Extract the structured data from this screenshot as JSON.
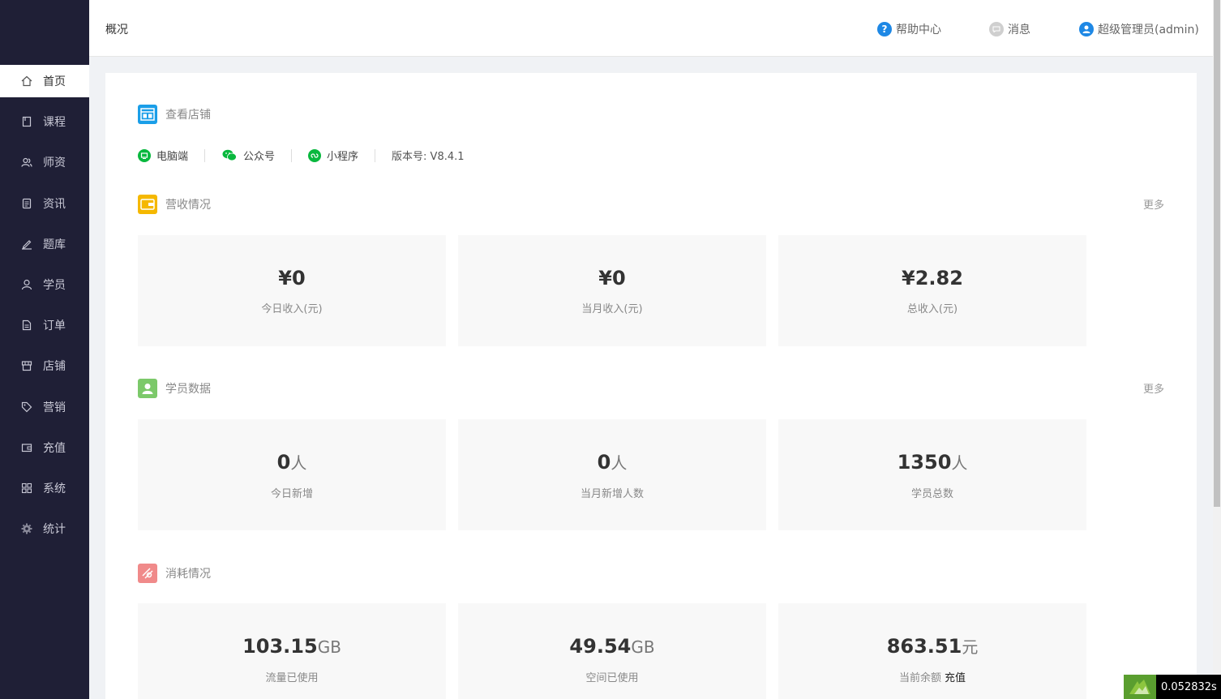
{
  "sidebar": {
    "items": [
      {
        "label": "首页",
        "icon": "home-icon",
        "active": true
      },
      {
        "label": "课程",
        "icon": "book-icon"
      },
      {
        "label": "师资",
        "icon": "teachers-icon"
      },
      {
        "label": "资讯",
        "icon": "news-icon"
      },
      {
        "label": "题库",
        "icon": "pen-icon"
      },
      {
        "label": "学员",
        "icon": "user-icon"
      },
      {
        "label": "订单",
        "icon": "document-icon"
      },
      {
        "label": "店铺",
        "icon": "store-icon"
      },
      {
        "label": "营销",
        "icon": "tag-icon"
      },
      {
        "label": "充值",
        "icon": "wallet-icon"
      },
      {
        "label": "系统",
        "icon": "grid-icon"
      },
      {
        "label": "统计",
        "icon": "gear-icon"
      }
    ]
  },
  "header": {
    "breadcrumb": "概况",
    "help": "帮助中心",
    "messages": "消息",
    "user": "超级管理员(admin)"
  },
  "store": {
    "title": "查看店铺",
    "platforms": [
      "电脑端",
      "公众号",
      "小程序"
    ],
    "version": "版本号: V8.4.1"
  },
  "revenue": {
    "title": "营收情况",
    "more": "更多",
    "cards": [
      {
        "value": "¥0",
        "label": "今日收入(元)"
      },
      {
        "value": "¥0",
        "label": "当月收入(元)"
      },
      {
        "value": "¥2.82",
        "label": "总收入(元)"
      }
    ]
  },
  "students": {
    "title": "学员数据",
    "more": "更多",
    "cards": [
      {
        "value": "0",
        "unit": "人",
        "label": "今日新增"
      },
      {
        "value": "0",
        "unit": "人",
        "label": "当月新增人数"
      },
      {
        "value": "1350",
        "unit": "人",
        "label": "学员总数"
      }
    ]
  },
  "consumption": {
    "title": "消耗情况",
    "cards": [
      {
        "value": "103.15",
        "unit": "GB",
        "label": "流量已使用"
      },
      {
        "value": "49.54",
        "unit": "GB",
        "label": "空间已使用"
      },
      {
        "value": "863.51",
        "unit": "元",
        "label": "当前余额",
        "action": "充值"
      }
    ]
  },
  "timer": "0.052832s",
  "colors": {
    "sidebar_bg": "#1f1f36",
    "help_blue": "#1e88e5",
    "wechat_green": "#09b83e",
    "store_icon": "#1a9ee8",
    "revenue_icon": "#f5b800",
    "students_icon": "#7cc96a",
    "consumption_icon": "#f08a8a"
  }
}
